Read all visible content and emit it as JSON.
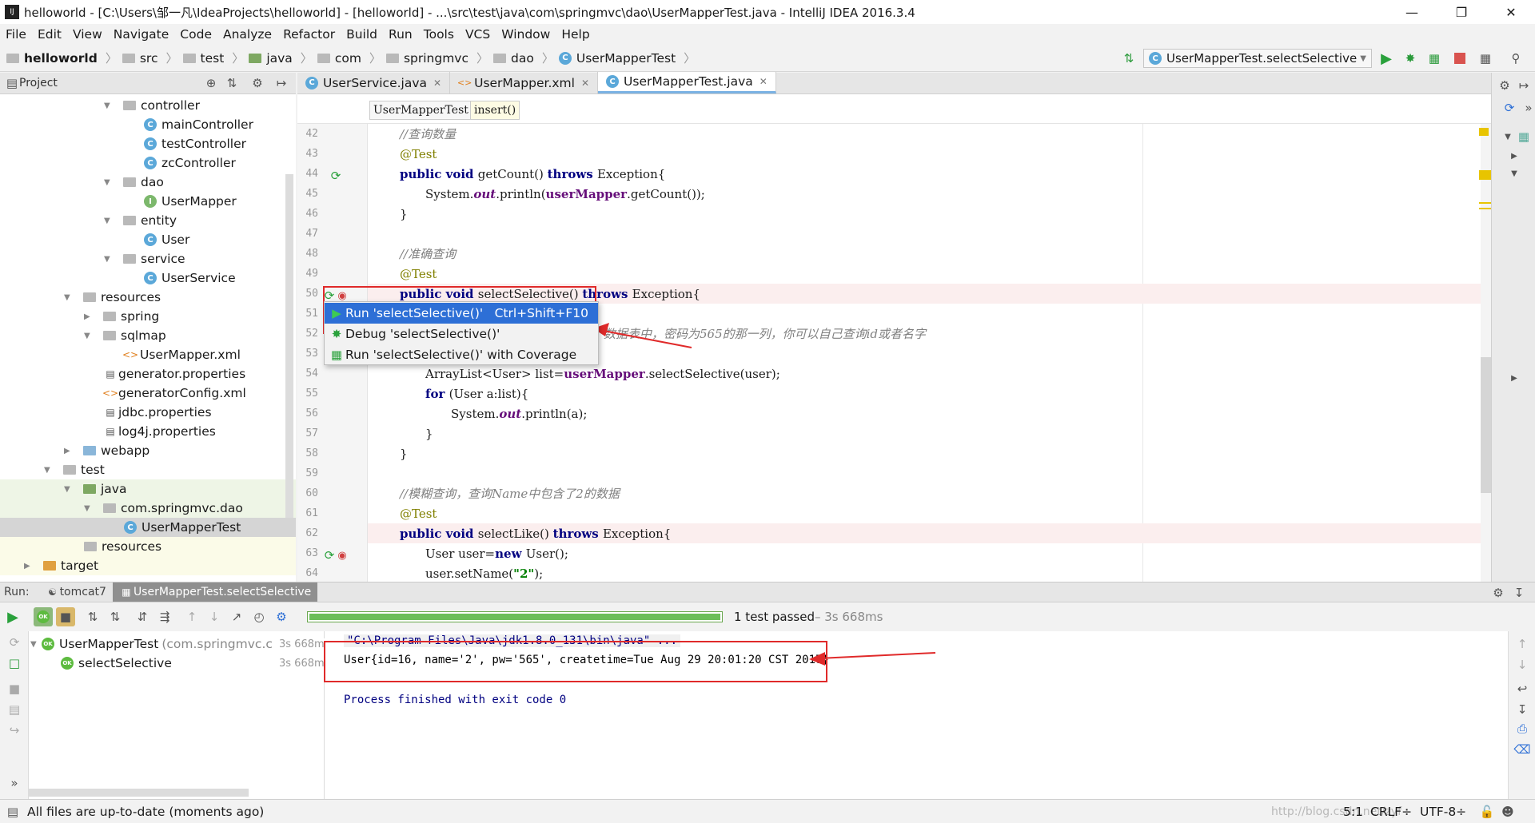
{
  "window": {
    "title": "helloworld - [C:\\Users\\邹一凡\\IdeaProjects\\helloworld] - [helloworld] - ...\\src\\test\\java\\com\\springmvc\\dao\\UserMapperTest.java - IntelliJ IDEA 2016.3.4"
  },
  "menu": [
    "File",
    "Edit",
    "View",
    "Navigate",
    "Code",
    "Analyze",
    "Refactor",
    "Build",
    "Run",
    "Tools",
    "VCS",
    "Window",
    "Help"
  ],
  "nav": {
    "crumbs": [
      "helloworld",
      "src",
      "test",
      "java",
      "com",
      "springmvc",
      "dao",
      "UserMapperTest"
    ],
    "run_config": "UserMapperTest.selectSelective"
  },
  "project": {
    "header": "Project",
    "items": [
      {
        "label": "controller",
        "kind": "pkg"
      },
      {
        "label": "mainController",
        "kind": "class"
      },
      {
        "label": "testController",
        "kind": "class"
      },
      {
        "label": "zcController",
        "kind": "class"
      },
      {
        "label": "dao",
        "kind": "pkg"
      },
      {
        "label": "UserMapper",
        "kind": "iface"
      },
      {
        "label": "entity",
        "kind": "pkg"
      },
      {
        "label": "User",
        "kind": "class"
      },
      {
        "label": "service",
        "kind": "pkg"
      },
      {
        "label": "UserService",
        "kind": "class"
      },
      {
        "label": "resources",
        "kind": "folder"
      },
      {
        "label": "spring",
        "kind": "folder"
      },
      {
        "label": "sqlmap",
        "kind": "folder"
      },
      {
        "label": "UserMapper.xml",
        "kind": "xml"
      },
      {
        "label": "generator.properties",
        "kind": "prop"
      },
      {
        "label": "generatorConfig.xml",
        "kind": "xml"
      },
      {
        "label": "jdbc.properties",
        "kind": "prop"
      },
      {
        "label": "log4j.properties",
        "kind": "prop"
      },
      {
        "label": "webapp",
        "kind": "folder"
      },
      {
        "label": "test",
        "kind": "folder"
      },
      {
        "label": "java",
        "kind": "folder"
      },
      {
        "label": "com.springmvc.dao",
        "kind": "pkg"
      },
      {
        "label": "UserMapperTest",
        "kind": "class"
      },
      {
        "label": "resources",
        "kind": "folder"
      },
      {
        "label": "target",
        "kind": "folder"
      }
    ]
  },
  "tabs": [
    {
      "label": "UserService.java",
      "icon": "class-icon"
    },
    {
      "label": "UserMapper.xml",
      "icon": "xml-icon"
    },
    {
      "label": "UserMapperTest.java",
      "icon": "class-icon",
      "active": true
    }
  ],
  "editor_breadcrumb": [
    "UserMapperTest",
    "insert()"
  ],
  "code": {
    "line_numbers": [
      "42",
      "43",
      "44",
      "45",
      "46",
      "47",
      "48",
      "49",
      "50",
      "51",
      "52",
      "53",
      "54",
      "55",
      "56",
      "57",
      "58",
      "59",
      "60",
      "61",
      "62",
      "63",
      "64"
    ],
    "c42": "//查询数量",
    "c43": "@Test",
    "c44a": "public void ",
    "c44b": "getCount() ",
    "c44c": "throws ",
    "c44d": "Exception{",
    "c45a": "System.",
    "c45b": "out",
    "c45c": ".println(",
    "c45d": "userMapper",
    "c45e": ".getCount());",
    "c46": "}",
    "c48": "//准确查询",
    "c49": "@Test",
    "c50a": "public void ",
    "c50b": "selectSelective() ",
    "c50c": "throws ",
    "c50d": "Exception{",
    "c52": "数据表中，密码为565的那一列，你可以自己查询id或者名字",
    "c54a": "ArrayList<User> list=",
    "c54b": "userMapper",
    "c54c": ".selectSelective(user);",
    "c55a": "for ",
    "c55b": "(User a:list){",
    "c56a": "System.",
    "c56b": "out",
    "c56c": ".println(a);",
    "c57": "}",
    "c58": "}",
    "c60": "//模糊查询，查询Name中包含了2的数据",
    "c61": "@Test",
    "c62a": "public void ",
    "c62b": "selectLike() ",
    "c62c": "throws ",
    "c62d": "Exception{",
    "c63a": "User user=",
    "c63b": "new ",
    "c63c": "User();",
    "c64a": "user.setName(",
    "c64b": "\"2\"",
    "c64c": ");"
  },
  "popup": {
    "items": [
      {
        "label": "Run 'selectSelective()'",
        "shortcut": "Ctrl+Shift+F10",
        "selected": true
      },
      {
        "label": "Debug 'selectSelective()'",
        "shortcut": ""
      },
      {
        "label": "Run 'selectSelective()' with Coverage",
        "shortcut": ""
      }
    ]
  },
  "run": {
    "label": "Run:",
    "tabs": [
      "tomcat7",
      "UserMapperTest.selectSelective"
    ],
    "progress": 1.0,
    "status_main": "1 test passed",
    "status_time": " – 3s 668ms",
    "tree": [
      {
        "label": "UserMapperTest",
        "detail": "(com.springmvc.c",
        "time": "3s 668ms"
      },
      {
        "label": "selectSelective",
        "detail": "",
        "time": "3s 668ms"
      }
    ],
    "console": [
      "\"C:\\Program Files\\Java\\jdk1.8.0_131\\bin\\java\" ...",
      "User{id=16, name='2', pw='565', createtime=Tue Aug 29 20:01:20 CST 2017}",
      "Process finished with exit code 0"
    ]
  },
  "statusbar": {
    "message": "All files are up-to-date (moments ago)",
    "position": "5:1",
    "line_sep": "CRLF÷",
    "encoding": "UTF-8÷",
    "watermark": "http://blog.csdn.net/zyf"
  },
  "colors": {
    "accent": "#2d6fd6",
    "annotation_red": "#e02a2a",
    "pass_green": "#5dbb3f"
  }
}
